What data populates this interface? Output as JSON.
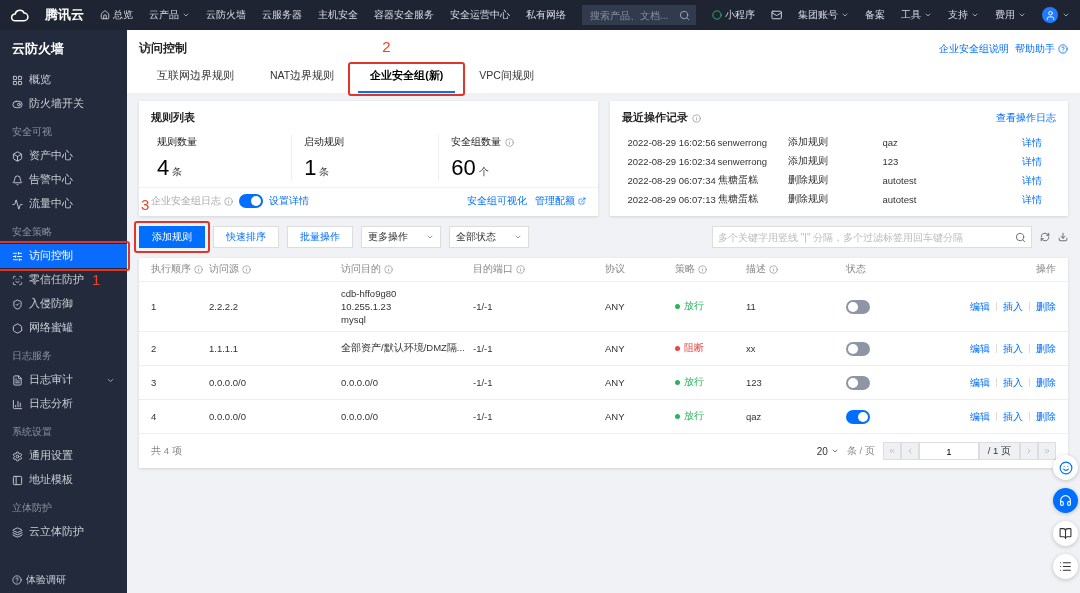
{
  "topbar": {
    "brand": "腾讯云",
    "home": "总览",
    "nav": [
      {
        "label": "云产品",
        "dropdown": true
      },
      {
        "label": "云防火墙",
        "dropdown": false
      },
      {
        "label": "云服务器",
        "dropdown": false
      },
      {
        "label": "主机安全",
        "dropdown": false
      },
      {
        "label": "容器安全服务",
        "dropdown": false
      },
      {
        "label": "安全运营中心",
        "dropdown": false
      },
      {
        "label": "私有网络",
        "dropdown": false
      }
    ],
    "search": {
      "placeholder": "搜索产品、文档..."
    },
    "right": [
      {
        "kind": "mini",
        "label": "小程序"
      },
      {
        "kind": "mail"
      },
      {
        "kind": "menu",
        "label": "集团账号",
        "dropdown": true
      },
      {
        "kind": "menu",
        "label": "备案",
        "dropdown": false
      },
      {
        "kind": "menu",
        "label": "工具",
        "dropdown": true
      },
      {
        "kind": "menu",
        "label": "支持",
        "dropdown": true
      },
      {
        "kind": "menu",
        "label": "费用",
        "dropdown": true
      },
      {
        "kind": "avatar"
      }
    ]
  },
  "sidebar": {
    "title": "云防火墙",
    "sections": [
      {
        "items": [
          {
            "label": "概览",
            "selected": false
          },
          {
            "label": "防火墙开关",
            "selected": false
          }
        ]
      },
      {
        "heading": "安全可视",
        "items": [
          {
            "label": "资产中心",
            "selected": false
          },
          {
            "label": "告警中心",
            "selected": false
          },
          {
            "label": "流量中心",
            "selected": false
          }
        ]
      },
      {
        "heading": "安全策略",
        "items": [
          {
            "label": "访问控制",
            "selected": true,
            "callout": "1"
          },
          {
            "label": "零信任防护",
            "selected": false
          },
          {
            "label": "入侵防御",
            "selected": false
          },
          {
            "label": "网络蜜罐",
            "selected": false
          }
        ]
      },
      {
        "heading": "日志服务",
        "items": [
          {
            "label": "日志审计",
            "selected": false,
            "expandable": true
          },
          {
            "label": "日志分析",
            "selected": false
          }
        ]
      },
      {
        "heading": "系统设置",
        "items": [
          {
            "label": "通用设置",
            "selected": false
          },
          {
            "label": "地址模板",
            "selected": false
          }
        ]
      },
      {
        "heading": "立体防护",
        "items": [
          {
            "label": "云立体防护",
            "selected": false
          }
        ]
      }
    ],
    "footer": "体验调研"
  },
  "page": {
    "title": "访问控制",
    "links": [
      "企业安全组说明",
      "帮助助手"
    ],
    "tabs": [
      {
        "label": "互联网边界规则",
        "selected": false
      },
      {
        "label": "NAT边界规则",
        "selected": false
      },
      {
        "label": "企业安全组(新)",
        "selected": true,
        "callout": "2"
      },
      {
        "label": "VPC间规则",
        "selected": false
      }
    ]
  },
  "rules_card": {
    "title": "规则列表",
    "stats": [
      {
        "label": "规则数量",
        "value": "4",
        "unit": "条",
        "info": false
      },
      {
        "label": "启动规则",
        "value": "1",
        "unit": "条",
        "info": false
      },
      {
        "label": "安全组数量",
        "value": "60",
        "unit": "个",
        "info": true
      }
    ],
    "log": {
      "label": "企业安全组日志",
      "disabled": true,
      "on": true,
      "link": "设置详情"
    },
    "links": [
      "安全组可视化",
      "管理配额"
    ]
  },
  "recent": {
    "title": "最近操作记录",
    "link": "查看操作日志",
    "rows": [
      {
        "time": "2022-08-29 16:02:56",
        "user": "senwerrong",
        "action": "添加规则",
        "target": "qaz",
        "link": "详情"
      },
      {
        "time": "2022-08-29 16:02:34",
        "user": "senwerrong",
        "action": "添加规则",
        "target": "123",
        "link": "详情"
      },
      {
        "time": "2022-08-29 06:07:34",
        "user": "焦糖蛋糕",
        "action": "删除规则",
        "target": "autotest",
        "link": "详情"
      },
      {
        "time": "2022-08-29 06:07:13",
        "user": "焦糖蛋糕",
        "action": "删除规则",
        "target": "autotest",
        "link": "详情"
      }
    ]
  },
  "toolbar": {
    "buttons": [
      {
        "label": "添加规则",
        "primary": true,
        "callout": "3"
      },
      {
        "label": "快速排序",
        "primary": false
      },
      {
        "label": "批量操作",
        "primary": false
      }
    ],
    "selects": [
      "更多操作",
      "全部状态"
    ],
    "search": {
      "placeholder": "多个关键字用竖线 \"|\" 分隔，多个过滤标签用回车键分隔"
    }
  },
  "table": {
    "columns": [
      {
        "label": "执行顺序",
        "info": true
      },
      {
        "label": "访问源",
        "info": true
      },
      {
        "label": "访问目的",
        "info": true
      },
      {
        "label": "目的端口",
        "info": true
      },
      {
        "label": "协议",
        "info": false
      },
      {
        "label": "策略",
        "info": true
      },
      {
        "label": "描述",
        "info": true
      },
      {
        "label": "状态",
        "info": false
      },
      {
        "label": "操作",
        "info": false
      }
    ],
    "rows": [
      {
        "order": "1",
        "source": "2.2.2.2",
        "dest": [
          "cdb-hffo9g80",
          "10.255.1.23",
          "mysql"
        ],
        "port": "-1/-1",
        "protocol": "ANY",
        "policy": {
          "label": "放行",
          "color": "#29b35a"
        },
        "desc": "11",
        "on": false,
        "actions": [
          "编辑",
          "插入",
          "删除"
        ]
      },
      {
        "order": "2",
        "source": "1.1.1.1",
        "dest": [
          "全部资产/默认环境/DMZ隔..."
        ],
        "port": "-1/-1",
        "protocol": "ANY",
        "policy": {
          "label": "阻断",
          "color": "#e54545"
        },
        "desc": "xx",
        "on": false,
        "actions": [
          "编辑",
          "插入",
          "删除"
        ]
      },
      {
        "order": "3",
        "source": "0.0.0.0/0",
        "dest": [
          "0.0.0.0/0"
        ],
        "port": "-1/-1",
        "protocol": "ANY",
        "policy": {
          "label": "放行",
          "color": "#29b35a"
        },
        "desc": "123",
        "on": false,
        "actions": [
          "编辑",
          "插入",
          "删除"
        ]
      },
      {
        "order": "4",
        "source": "0.0.0.0/0",
        "dest": [
          "0.0.0.0/0"
        ],
        "port": "-1/-1",
        "protocol": "ANY",
        "policy": {
          "label": "放行",
          "color": "#29b35a"
        },
        "desc": "qaz",
        "on": true,
        "actions": [
          "编辑",
          "插入",
          "删除"
        ]
      }
    ],
    "footer": {
      "total": "共 4 项",
      "page_size": "20",
      "per_page": "条 / 页",
      "page": "1",
      "pages": "/ 1 页"
    }
  }
}
